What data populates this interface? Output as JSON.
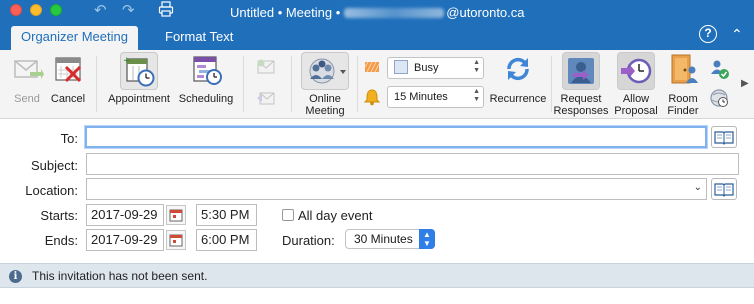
{
  "window": {
    "title_prefix": "Untitled • Meeting •",
    "title_suffix": "@utoronto.ca"
  },
  "tabs": [
    {
      "label": "Organizer Meeting"
    },
    {
      "label": "Format Text"
    }
  ],
  "ribbon": {
    "send_label": "Send",
    "cancel_label": "Cancel",
    "appointment_label": "Appointment",
    "scheduling_label": "Scheduling",
    "online_meeting_label": "Online\nMeeting",
    "show_as_value": "Busy",
    "reminder_value": "15 Minutes",
    "recurrence_label": "Recurrence",
    "request_responses_label": "Request\nResponses",
    "allow_proposal_label": "Allow\nProposal",
    "room_finder_label": "Room\nFinder"
  },
  "form": {
    "to_label": "To:",
    "to_value": "",
    "subject_label": "Subject:",
    "subject_value": "",
    "location_label": "Location:",
    "location_value": "",
    "starts_label": "Starts:",
    "start_date": "2017-09-29",
    "start_time": "5:30 PM",
    "all_day_label": "All day event",
    "all_day_checked": false,
    "ends_label": "Ends:",
    "end_date": "2017-09-29",
    "end_time": "6:00 PM",
    "duration_label": "Duration:",
    "duration_value": "30 Minutes"
  },
  "infobar": {
    "message": "This invitation has not been sent."
  },
  "colors": {
    "titlebar": "#1f6fbb",
    "ribbon": "#f4f4f4",
    "infobar": "#dde5ed",
    "accent": "#2f7fe6"
  }
}
